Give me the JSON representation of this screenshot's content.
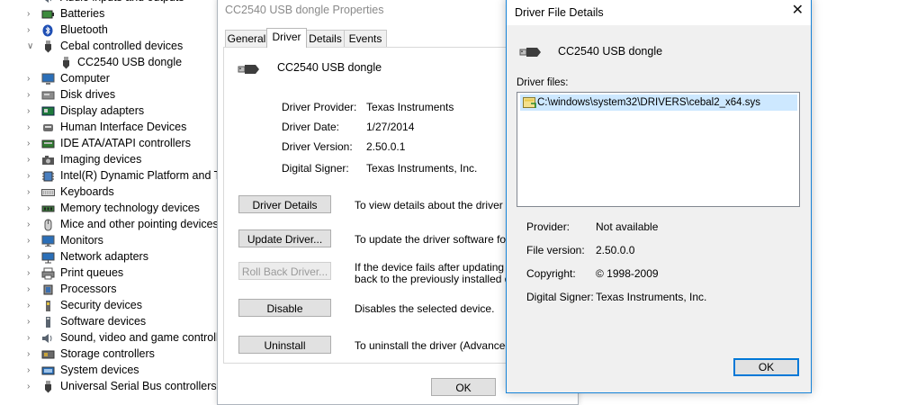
{
  "tree": {
    "items": [
      {
        "label": "Audio inputs and outputs",
        "icon": "speaker-icon",
        "expanded": false
      },
      {
        "label": "Batteries",
        "icon": "battery-icon",
        "expanded": false
      },
      {
        "label": "Bluetooth",
        "icon": "bluetooth-icon",
        "expanded": false
      },
      {
        "label": "Cebal controlled devices",
        "icon": "usb-plug-icon",
        "expanded": true
      },
      {
        "label": "CC2540 USB dongle",
        "icon": "usb-plug-icon",
        "child": true
      },
      {
        "label": "Computer",
        "icon": "computer-icon",
        "expanded": false
      },
      {
        "label": "Disk drives",
        "icon": "disk-drive-icon",
        "expanded": false
      },
      {
        "label": "Display adapters",
        "icon": "display-adapter-icon",
        "expanded": false
      },
      {
        "label": "Human Interface Devices",
        "icon": "hid-icon",
        "expanded": false
      },
      {
        "label": "IDE ATA/ATAPI controllers",
        "icon": "ide-controller-icon",
        "expanded": false
      },
      {
        "label": "Imaging devices",
        "icon": "camera-icon",
        "expanded": false
      },
      {
        "label": "Intel(R) Dynamic Platform and Th",
        "icon": "chip-icon",
        "expanded": false
      },
      {
        "label": "Keyboards",
        "icon": "keyboard-icon",
        "expanded": false
      },
      {
        "label": "Memory technology devices",
        "icon": "memory-icon",
        "expanded": false
      },
      {
        "label": "Mice and other pointing devices",
        "icon": "mouse-icon",
        "expanded": false
      },
      {
        "label": "Monitors",
        "icon": "monitor-icon",
        "expanded": false
      },
      {
        "label": "Network adapters",
        "icon": "network-adapter-icon",
        "expanded": false
      },
      {
        "label": "Print queues",
        "icon": "printer-icon",
        "expanded": false
      },
      {
        "label": "Processors",
        "icon": "processor-icon",
        "expanded": false
      },
      {
        "label": "Security devices",
        "icon": "security-device-icon",
        "expanded": false
      },
      {
        "label": "Software devices",
        "icon": "software-device-icon",
        "expanded": false
      },
      {
        "label": "Sound, video and game controlle",
        "icon": "speaker-icon",
        "expanded": false
      },
      {
        "label": "Storage controllers",
        "icon": "storage-controller-icon",
        "expanded": false
      },
      {
        "label": "System devices",
        "icon": "system-device-icon",
        "expanded": false
      },
      {
        "label": "Universal Serial Bus controllers",
        "icon": "usb-controller-icon",
        "expanded": false
      }
    ]
  },
  "properties": {
    "title": "CC2540 USB dongle Properties",
    "tabs": [
      "General",
      "Driver",
      "Details",
      "Events"
    ],
    "active_tab": "Driver",
    "device_name": "CC2540 USB dongle",
    "info": [
      {
        "label": "Driver Provider:",
        "value": "Texas Instruments"
      },
      {
        "label": "Driver Date:",
        "value": "1/27/2014"
      },
      {
        "label": "Driver Version:",
        "value": "2.50.0.1"
      },
      {
        "label": "Digital Signer:",
        "value": "Texas Instruments, Inc."
      }
    ],
    "actions": [
      {
        "button": "Driver Details",
        "desc": "To view details about the driver files.",
        "enabled": true
      },
      {
        "button": "Update Driver...",
        "desc": "To update the driver software for this",
        "enabled": true
      },
      {
        "button": "Roll Back Driver...",
        "desc": "If the device fails after updating the d\nback to the previously installed driver",
        "enabled": false
      },
      {
        "button": "Disable",
        "desc": "Disables the selected device.",
        "enabled": true
      },
      {
        "button": "Uninstall",
        "desc": "To uninstall the driver (Advanced).",
        "enabled": true
      }
    ],
    "ok_label": "OK"
  },
  "details": {
    "title": "Driver File Details",
    "close_glyph": "✕",
    "device_name": "CC2540 USB dongle",
    "files_label": "Driver files:",
    "files": [
      "C:\\windows\\system32\\DRIVERS\\cebal2_x64.sys"
    ],
    "info": [
      {
        "label": "Provider:",
        "value": "Not available"
      },
      {
        "label": "File version:",
        "value": "2.50.0.0"
      },
      {
        "label": "Copyright:",
        "value": "© 1998-2009"
      },
      {
        "label": "Digital Signer:",
        "value": "Texas Instruments, Inc."
      }
    ],
    "ok_label": "OK"
  },
  "colors": {
    "accent": "#0078d7",
    "selection": "#cde8ff",
    "dialog_bg": "#f0f0f0"
  }
}
